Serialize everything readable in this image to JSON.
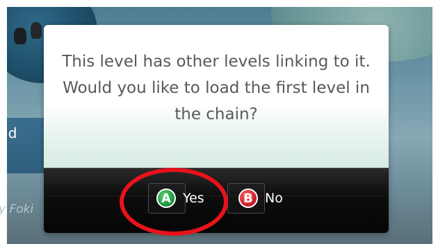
{
  "background": {
    "world_label": "rld",
    "bottom_text": "y Foki"
  },
  "dialog": {
    "message": "This level has other levels linking to it.  Would you like to load the first level in the chain?",
    "buttons": [
      {
        "glyph": "A",
        "label": "Yes",
        "icon": "a-button-icon",
        "color": "#1f9a3e"
      },
      {
        "glyph": "B",
        "label": "No",
        "icon": "b-button-icon",
        "color": "#d21f2a"
      }
    ]
  },
  "annotation": {
    "highlight_color": "#e8121b",
    "highlighted": "Yes"
  }
}
